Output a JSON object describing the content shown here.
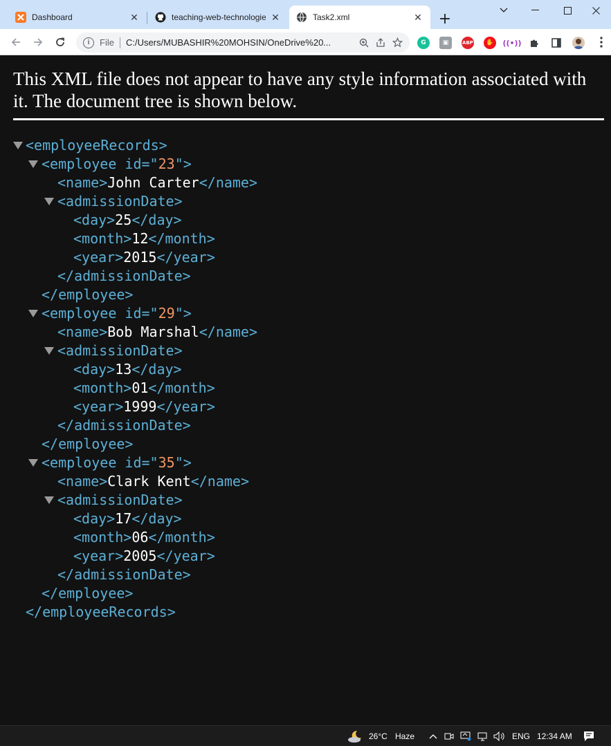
{
  "tabs": [
    {
      "title": "Dashboard",
      "icon": "xampp-icon"
    },
    {
      "title": "teaching-web-technologie",
      "icon": "github-icon"
    },
    {
      "title": "Task2.xml",
      "icon": "globe-icon"
    }
  ],
  "omnibox": {
    "scheme": "File",
    "url": "C:/Users/MUBASHIR%20MOHSIN/OneDrive%20..."
  },
  "extensions": {
    "abp": "ABP"
  },
  "page": {
    "notice": "This XML file does not appear to have any style information associated with it. The document tree is shown below."
  },
  "xml": {
    "root": "employeeRecords",
    "employee_tag": "employee",
    "attr_name": "id",
    "name_tag": "name",
    "date_tag": "admissionDate",
    "day_tag": "day",
    "month_tag": "month",
    "year_tag": "year",
    "employees": [
      {
        "id": "23",
        "name": "John Carter",
        "day": "25",
        "month": "12",
        "year": "2015"
      },
      {
        "id": "29",
        "name": "Bob Marshal",
        "day": "13",
        "month": "01",
        "year": "1999"
      },
      {
        "id": "35",
        "name": "Clark Kent",
        "day": "17",
        "month": "06",
        "year": "2005"
      }
    ]
  },
  "taskbar": {
    "temp": "26°C",
    "weather": "Haze",
    "lang": "ENG",
    "time": "12:34 AM"
  },
  "colors": {
    "tag": "#5db0d7",
    "attr_value": "#f29766",
    "text": "#ffffff",
    "background": "#121212"
  }
}
